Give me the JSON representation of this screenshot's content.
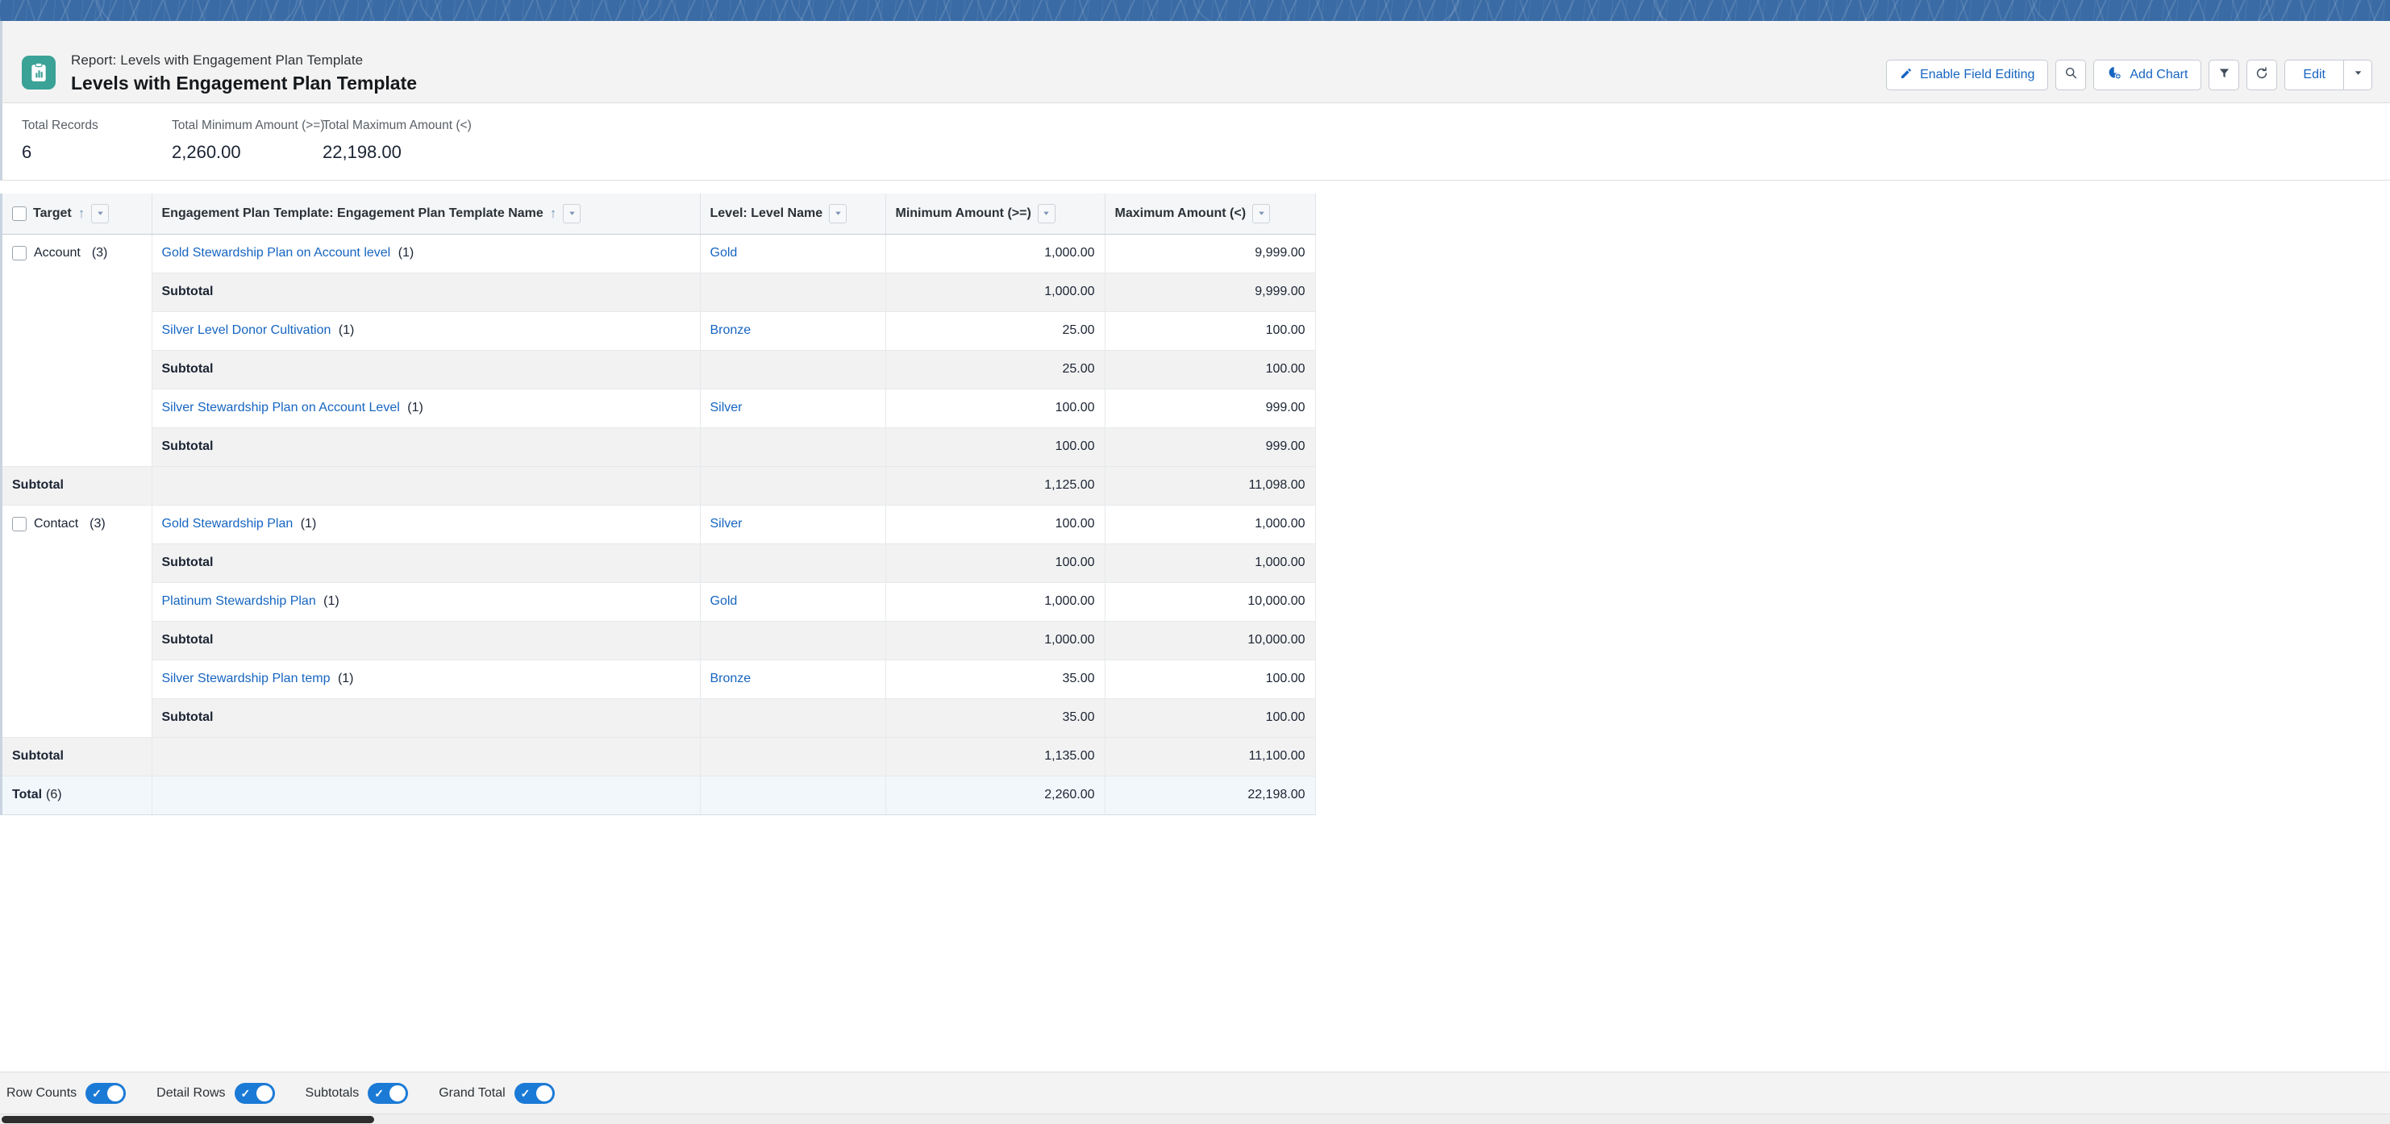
{
  "header": {
    "eyebrow": "Report: Levels with Engagement Plan Template",
    "title": "Levels with Engagement Plan Template",
    "icon": "report-clipboard-chart-icon"
  },
  "toolbar": {
    "enable_field_editing_label": "Enable Field Editing",
    "search_icon": "search-icon",
    "add_chart_label": "Add Chart",
    "add_chart_icon": "chart-pie-icon",
    "filter_icon": "filter-funnel-icon",
    "refresh_icon": "refresh-icon",
    "edit_label": "Edit",
    "edit_caret_icon": "chevron-down-icon",
    "pencil_icon": "pencil-icon"
  },
  "summary": [
    {
      "label": "Total Records",
      "value": "6"
    },
    {
      "label": "Total Minimum Amount (>=)",
      "value": "2,260.00"
    },
    {
      "label": "Total Maximum Amount (<)",
      "value": "22,198.00"
    }
  ],
  "table": {
    "columns": [
      {
        "label": "Target",
        "sorted": true,
        "sort_icon": "sort-asc-arrow",
        "align": "left"
      },
      {
        "label": "Engagement Plan Template: Engagement Plan Template Name",
        "sorted": true,
        "sort_icon": "sort-asc-arrow",
        "align": "left"
      },
      {
        "label": "Level: Level Name",
        "sorted": false,
        "align": "left"
      },
      {
        "label": "Minimum Amount (>=)",
        "sorted": false,
        "align": "left"
      },
      {
        "label": "Maximum Amount (<)",
        "sorted": false,
        "align": "left"
      }
    ],
    "subtotal_label": "Subtotal",
    "total_label": "Total",
    "total_count": "(6)",
    "groups": [
      {
        "name": "Account",
        "count": "(3)",
        "rows": [
          {
            "template": "Gold Stewardship Plan on Account level",
            "template_count": "(1)",
            "level": "Gold",
            "min": "1,000.00",
            "max": "9,999.00",
            "sub_min": "1,000.00",
            "sub_max": "9,999.00"
          },
          {
            "template": "Silver Level Donor Cultivation",
            "template_count": "(1)",
            "level": "Bronze",
            "min": "25.00",
            "max": "100.00",
            "sub_min": "25.00",
            "sub_max": "100.00"
          },
          {
            "template": "Silver Stewardship Plan on Account Level",
            "template_count": "(1)",
            "level": "Silver",
            "min": "100.00",
            "max": "999.00",
            "sub_min": "100.00",
            "sub_max": "999.00"
          }
        ],
        "group_sub_min": "1,125.00",
        "group_sub_max": "11,098.00"
      },
      {
        "name": "Contact",
        "count": "(3)",
        "rows": [
          {
            "template": "Gold Stewardship Plan",
            "template_count": "(1)",
            "level": "Silver",
            "min": "100.00",
            "max": "1,000.00",
            "sub_min": "100.00",
            "sub_max": "1,000.00"
          },
          {
            "template": "Platinum Stewardship Plan",
            "template_count": "(1)",
            "level": "Gold",
            "min": "1,000.00",
            "max": "10,000.00",
            "sub_min": "1,000.00",
            "sub_max": "10,000.00"
          },
          {
            "template": "Silver Stewardship Plan temp",
            "template_count": "(1)",
            "level": "Bronze",
            "min": "35.00",
            "max": "100.00",
            "sub_min": "35.00",
            "sub_max": "100.00"
          }
        ],
        "group_sub_min": "1,135.00",
        "group_sub_max": "11,100.00"
      }
    ],
    "grand_total_min": "2,260.00",
    "grand_total_max": "22,198.00"
  },
  "footer_toggles": [
    {
      "label": "Row Counts",
      "on": true
    },
    {
      "label": "Detail Rows",
      "on": true
    },
    {
      "label": "Subtotals",
      "on": true
    },
    {
      "label": "Grand Total",
      "on": true
    }
  ],
  "colors": {
    "link": "#1665c1",
    "banner": "#3a6ba5",
    "icon_bg": "#3aa297",
    "toggle_on": "#1b7ad6",
    "total_row_bg": "#f1f7fb",
    "subtotal_bg": "#f2f2f2"
  }
}
